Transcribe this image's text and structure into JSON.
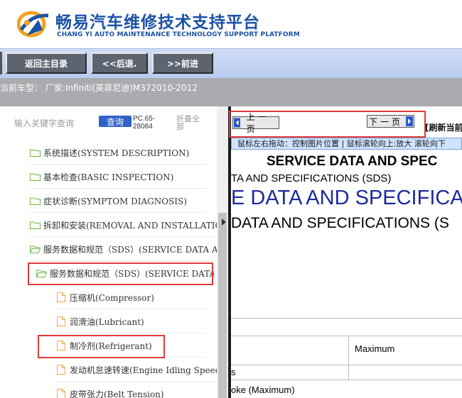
{
  "header": {
    "title_cn": "畅易汽车维修技术支持平台",
    "title_en": "CHANG YI AUTO MAINTENANCE TECHNOLOGY SUPPORT PLATFORM"
  },
  "nav": {
    "home_label": "返回主目录",
    "back_label": "<<后退.",
    "forward_label": ">>前进"
  },
  "car": {
    "label": "当前车型：",
    "value": "厂家:Infiniti(英菲尼迪)M372010-2012"
  },
  "search": {
    "placeholder": "输入关键字查询",
    "query_label": "查询",
    "pc_code": "PC.65-28084",
    "collapse_label": "折叠全部"
  },
  "tree": {
    "items": [
      {
        "label": "系统描述(SYSTEM DESCRIPTION)"
      },
      {
        "label": "基本检查(BASIC INSPECTION)"
      },
      {
        "label": "症状诊断(SYMPTOM DIAGNOSIS)"
      },
      {
        "label": "拆卸和安装(REMOVAL AND INSTALLATIO"
      },
      {
        "label": "服务数据和规范（SDS）(SERVICE DATA A"
      },
      {
        "label": "服务数据和规范（SDS）(SERVICE DATA"
      },
      {
        "label": "压缩机(Compressor)"
      },
      {
        "label": "润滑油(Lubricant)"
      },
      {
        "label": "制冷剂(Refrigerant)"
      },
      {
        "label": "发动机怠速转速(Engine Idling Speed)"
      },
      {
        "label": "皮带张力(Belt Tension)"
      }
    ]
  },
  "viewer": {
    "prev_label": "上一页",
    "next_label": "下一页",
    "refresh_label": "[刷新当前",
    "hint": "鼠标左右拖动：控制图片位置 | 鼠标滚轮向上:放大   滚轮向下",
    "doc": {
      "heading": "SERVICE DATA AND SPEC",
      "sub": "TA AND SPECIFICATIONS (SDS)",
      "big": "E DATA AND SPECIFICA",
      "big2": "DATA AND SPECIFICATIONS (S",
      "cell_max": "Maximum",
      "cell_s": "s",
      "cell_stroke": "oke (Maximum)"
    }
  },
  "colors": {
    "brand_blue": "#1c52a5",
    "highlight_red": "#e03a3a",
    "query_blue": "#2f62c8"
  }
}
